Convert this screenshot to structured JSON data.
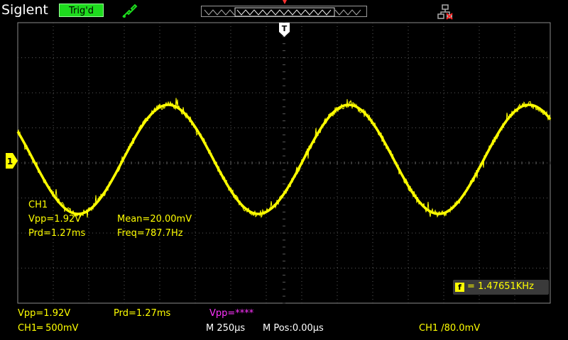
{
  "header": {
    "brand": "Siglent",
    "trigger_status": "Trig'd"
  },
  "colors": {
    "background": "#000000",
    "trace": "#ffff00",
    "grid": "#5a5a5a",
    "trig_status_bg": "#1edc1e",
    "math": "#ff33ff"
  },
  "icons": {
    "probe": "probe-icon",
    "network": "network-disconnected-icon",
    "trigger_position": "trigger-position-marker-icon",
    "channel_ground": "channel1-ground-marker-icon",
    "counter": "frequency-counter-icon"
  },
  "overlay": {
    "channel": "CH1",
    "vpp": "Vpp=1.92V",
    "mean": "Mean=20.00mV",
    "prd": "Prd=1.27ms",
    "freq": "Freq=787.7Hz"
  },
  "counter": {
    "value": "= 1.47651KHz"
  },
  "status_bar": {
    "vpp": "Vpp=1.92V",
    "prd": "Prd=1.27ms",
    "math_vpp": "Vpp=****",
    "ch1_scale": "CH1═ 500mV",
    "timebase": "M 250µs",
    "hpos": "M Pos:0.00µs",
    "trigger": "CH1 /80.0mV"
  },
  "markers": {
    "trigger_label": "T",
    "channel_label": "1"
  }
}
